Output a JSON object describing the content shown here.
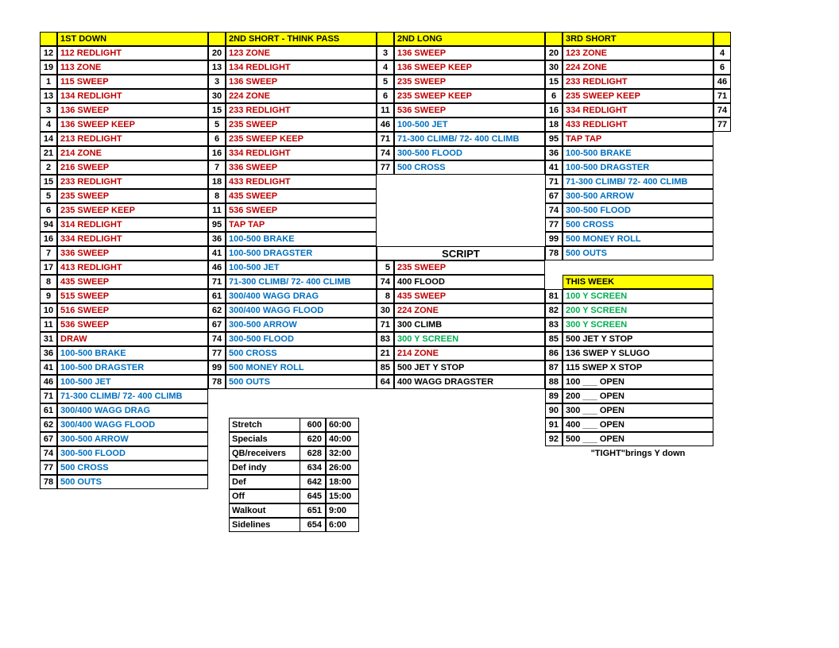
{
  "headers": {
    "c1": "1ST DOWN",
    "c2": "2ND SHORT - THINK PASS",
    "c3": "2ND LONG",
    "c4": "3RD SHORT"
  },
  "col1": [
    {
      "n": "12",
      "t": "112 REDLIGHT",
      "c": "red"
    },
    {
      "n": "19",
      "t": "113 ZONE",
      "c": "red"
    },
    {
      "n": "1",
      "t": "115 SWEEP",
      "c": "red"
    },
    {
      "n": "13",
      "t": "134 REDLIGHT",
      "c": "red"
    },
    {
      "n": "3",
      "t": "136 SWEEP",
      "c": "red"
    },
    {
      "n": "4",
      "t": "136 SWEEP KEEP",
      "c": "red"
    },
    {
      "n": "14",
      "t": "213 REDLIGHT",
      "c": "red"
    },
    {
      "n": "21",
      "t": "214 ZONE",
      "c": "red"
    },
    {
      "n": "2",
      "t": "216 SWEEP",
      "c": "red"
    },
    {
      "n": "15",
      "t": "233 REDLIGHT",
      "c": "red"
    },
    {
      "n": "5",
      "t": "235 SWEEP",
      "c": "red"
    },
    {
      "n": "6",
      "t": "235 SWEEP KEEP",
      "c": "red"
    },
    {
      "n": "94",
      "t": "314 REDLIGHT",
      "c": "red"
    },
    {
      "n": "16",
      "t": "334 REDLIGHT",
      "c": "red"
    },
    {
      "n": "7",
      "t": "336 SWEEP",
      "c": "red"
    },
    {
      "n": "17",
      "t": "413 REDLIGHT",
      "c": "red"
    },
    {
      "n": "8",
      "t": "435 SWEEP",
      "c": "red"
    },
    {
      "n": "9",
      "t": "515 SWEEP",
      "c": "red"
    },
    {
      "n": "10",
      "t": "516 SWEEP",
      "c": "red"
    },
    {
      "n": "11",
      "t": "536 SWEEP",
      "c": "red"
    },
    {
      "n": "31",
      "t": "DRAW",
      "c": "red"
    },
    {
      "n": "36",
      "t": "100-500 BRAKE",
      "c": "blue"
    },
    {
      "n": "41",
      "t": "100-500 DRAGSTER",
      "c": "blue"
    },
    {
      "n": "46",
      "t": "100-500 JET",
      "c": "blue"
    },
    {
      "n": "71",
      "t": "71-300 CLIMB/ 72- 400 CLIMB",
      "c": "blue"
    },
    {
      "n": "61",
      "t": "300/400 WAGG DRAG",
      "c": "blue"
    },
    {
      "n": "62",
      "t": "300/400 WAGG FLOOD",
      "c": "blue"
    },
    {
      "n": "67",
      "t": "300-500 ARROW",
      "c": "blue"
    },
    {
      "n": "74",
      "t": "300-500 FLOOD",
      "c": "blue"
    },
    {
      "n": "77",
      "t": "500 CROSS",
      "c": "blue"
    },
    {
      "n": "78",
      "t": "500 OUTS",
      "c": "blue"
    }
  ],
  "col2": [
    {
      "n": "20",
      "t": "123 ZONE",
      "c": "red"
    },
    {
      "n": "13",
      "t": "134 REDLIGHT",
      "c": "red"
    },
    {
      "n": "3",
      "t": "136 SWEEP",
      "c": "red"
    },
    {
      "n": "30",
      "t": "224 ZONE",
      "c": "red"
    },
    {
      "n": "15",
      "t": "233 REDLIGHT",
      "c": "red"
    },
    {
      "n": "5",
      "t": "235 SWEEP",
      "c": "red"
    },
    {
      "n": "6",
      "t": "235 SWEEP KEEP",
      "c": "red"
    },
    {
      "n": "16",
      "t": "334 REDLIGHT",
      "c": "red"
    },
    {
      "n": "7",
      "t": "336 SWEEP",
      "c": "red"
    },
    {
      "n": "18",
      "t": "433 REDLIGHT",
      "c": "red"
    },
    {
      "n": "8",
      "t": "435 SWEEP",
      "c": "red"
    },
    {
      "n": "11",
      "t": "536 SWEEP",
      "c": "red"
    },
    {
      "n": "95",
      "t": "TAP TAP",
      "c": "red"
    },
    {
      "n": "36",
      "t": "100-500 BRAKE",
      "c": "blue"
    },
    {
      "n": "41",
      "t": "100-500 DRAGSTER",
      "c": "blue"
    },
    {
      "n": "46",
      "t": "100-500 JET",
      "c": "blue"
    },
    {
      "n": "71",
      "t": "71-300 CLIMB/ 72- 400 CLIMB",
      "c": "blue"
    },
    {
      "n": "61",
      "t": "300/400 WAGG DRAG",
      "c": "blue"
    },
    {
      "n": "62",
      "t": "300/400 WAGG FLOOD",
      "c": "blue"
    },
    {
      "n": "67",
      "t": "300-500 ARROW",
      "c": "blue"
    },
    {
      "n": "74",
      "t": "300-500 FLOOD",
      "c": "blue"
    },
    {
      "n": "77",
      "t": "500 CROSS",
      "c": "blue"
    },
    {
      "n": "99",
      "t": "500 MONEY ROLL",
      "c": "blue"
    },
    {
      "n": "78",
      "t": "500 OUTS",
      "c": "blue"
    }
  ],
  "col3": [
    {
      "n": "3",
      "t": "136 SWEEP",
      "c": "red"
    },
    {
      "n": "4",
      "t": "136 SWEEP KEEP",
      "c": "red"
    },
    {
      "n": "5",
      "t": "235 SWEEP",
      "c": "red"
    },
    {
      "n": "6",
      "t": "235 SWEEP KEEP",
      "c": "red"
    },
    {
      "n": "11",
      "t": "536 SWEEP",
      "c": "red"
    },
    {
      "n": "46",
      "t": "100-500 JET",
      "c": "blue"
    },
    {
      "n": "71",
      "t": "71-300 CLIMB/ 72- 400 CLIMB",
      "c": "blue"
    },
    {
      "n": "74",
      "t": "300-500 FLOOD",
      "c": "blue"
    },
    {
      "n": "77",
      "t": "500 CROSS",
      "c": "blue"
    }
  ],
  "col4": [
    {
      "n": "20",
      "t": "123 ZONE",
      "c": "red"
    },
    {
      "n": "30",
      "t": "224 ZONE",
      "c": "red"
    },
    {
      "n": "15",
      "t": "233 REDLIGHT",
      "c": "red"
    },
    {
      "n": "6",
      "t": "235 SWEEP KEEP",
      "c": "red"
    },
    {
      "n": "16",
      "t": "334 REDLIGHT",
      "c": "red"
    },
    {
      "n": "18",
      "t": "433 REDLIGHT",
      "c": "red"
    },
    {
      "n": "95",
      "t": "TAP TAP",
      "c": "red"
    },
    {
      "n": "36",
      "t": "100-500 BRAKE",
      "c": "blue"
    },
    {
      "n": "41",
      "t": "100-500 DRAGSTER",
      "c": "blue"
    },
    {
      "n": "71",
      "t": "71-300 CLIMB/ 72- 400 CLIMB",
      "c": "blue"
    },
    {
      "n": "67",
      "t": "300-500 ARROW",
      "c": "blue"
    },
    {
      "n": "74",
      "t": "300-500 FLOOD",
      "c": "blue"
    },
    {
      "n": "77",
      "t": "500 CROSS",
      "c": "blue"
    },
    {
      "n": "99",
      "t": "500 MONEY ROLL",
      "c": "blue"
    },
    {
      "n": "78",
      "t": "500 OUTS",
      "c": "blue"
    }
  ],
  "col5": [
    "4",
    "6",
    "46",
    "71",
    "74",
    "77"
  ],
  "scriptHdr": "SCRIPT",
  "script": [
    {
      "n": "5",
      "t": "235 SWEEP",
      "c": "red"
    },
    {
      "n": "74",
      "t": "400 FLOOD",
      "c": "black"
    },
    {
      "n": "8",
      "t": "435 SWEEP",
      "c": "red"
    },
    {
      "n": "30",
      "t": "224 ZONE",
      "c": "red"
    },
    {
      "n": "71",
      "t": "300 CLIMB",
      "c": "black"
    },
    {
      "n": "83",
      "t": "300 Y SCREEN",
      "c": "green"
    },
    {
      "n": "21",
      "t": "214 ZONE",
      "c": "red"
    },
    {
      "n": "85",
      "t": "500 JET Y STOP",
      "c": "black"
    },
    {
      "n": "64",
      "t": "400 WAGG DRAGSTER",
      "c": "black"
    }
  ],
  "thisWeekHdr": "THIS WEEK",
  "thisWeek": [
    {
      "n": "81",
      "t": "100 Y SCREEN",
      "c": "green"
    },
    {
      "n": "82",
      "t": "200 Y SCREEN",
      "c": "green"
    },
    {
      "n": "83",
      "t": "300 Y SCREEN",
      "c": "green"
    },
    {
      "n": "85",
      "t": "500 JET Y STOP",
      "c": "black"
    },
    {
      "n": "86",
      "t": "136 SWEP Y SLUGO",
      "c": "black"
    },
    {
      "n": "87",
      "t": "115 SWEP X STOP",
      "c": "black"
    },
    {
      "n": "88",
      "t": "100 ___ OPEN",
      "c": "black"
    },
    {
      "n": "89",
      "t": "200 ___ OPEN",
      "c": "black"
    },
    {
      "n": "90",
      "t": "300 ___ OPEN",
      "c": "black"
    },
    {
      "n": "91",
      "t": "400 ___ OPEN",
      "c": "black"
    },
    {
      "n": "92",
      "t": "500 ___ OPEN",
      "c": "black"
    }
  ],
  "tightNote": "\"TIGHT\"brings Y down",
  "schedule": [
    {
      "a": "Stretch",
      "b": "600",
      "c": "60:00"
    },
    {
      "a": "Specials",
      "b": "620",
      "c": "40:00"
    },
    {
      "a": "QB/receivers",
      "b": "628",
      "c": "32:00"
    },
    {
      "a": "Def indy",
      "b": "634",
      "c": "26:00"
    },
    {
      "a": "Def",
      "b": "642",
      "c": "18:00"
    },
    {
      "a": "Off",
      "b": "645",
      "c": "15:00"
    },
    {
      "a": "Walkout",
      "b": "651",
      "c": "9:00"
    },
    {
      "a": "Sidelines",
      "b": "654",
      "c": "6:00"
    }
  ]
}
